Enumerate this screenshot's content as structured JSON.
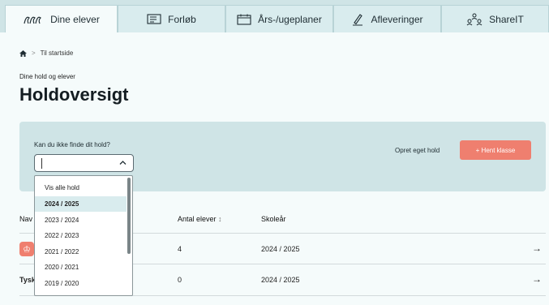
{
  "tabs": [
    {
      "label": "Dine elever",
      "icon": "students-icon",
      "active": true
    },
    {
      "label": "Forløb",
      "icon": "list-board-icon",
      "active": false
    },
    {
      "label": "Års-/ugeplaner",
      "icon": "calendar-icon",
      "active": false
    },
    {
      "label": "Afleveringer",
      "icon": "pencil-icon",
      "active": false
    },
    {
      "label": "ShareIT",
      "icon": "share-people-icon",
      "active": false
    }
  ],
  "breadcrumb": {
    "separator": ">",
    "link": "Til startside"
  },
  "page": {
    "kicker": "Dine hold og elever",
    "title": "Holdoversigt"
  },
  "panel": {
    "question": "Kan du ikke finde dit hold?",
    "create_link": "Opret eget hold",
    "fetch_button": "+ Hent klasse"
  },
  "dropdown": {
    "options": [
      "Vis alle hold",
      "2024 / 2025",
      "2023 / 2024",
      "2022 / 2023",
      "2021 / 2022",
      "2020 / 2021",
      "2019 / 2020"
    ],
    "selected": "2024 / 2025"
  },
  "table": {
    "columns": [
      "Nav",
      "Antal elever",
      "Skoleår"
    ],
    "sort_indicator": "↕",
    "rows": [
      {
        "name": "",
        "count": "4",
        "year": "2024 / 2025",
        "arrow": "→"
      },
      {
        "name": "Tysk",
        "count": "0",
        "year": "2024 / 2025",
        "arrow": "→"
      }
    ]
  },
  "colors": {
    "accent": "#ef7f6f",
    "panel": "#cfe4e6",
    "background": "#f5fbfb"
  }
}
